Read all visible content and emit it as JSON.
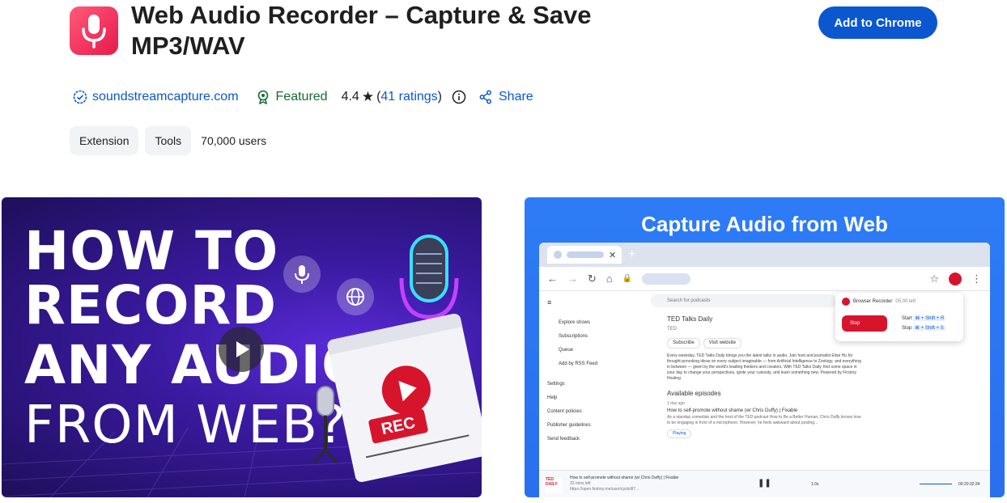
{
  "header": {
    "title": "Web Audio Recorder – Capture & Save MP3/WAV",
    "add_button": "Add to Chrome",
    "icon": "microphone-icon",
    "icon_color": "#e8194b"
  },
  "meta": {
    "site": "soundstreamcapture.com",
    "featured": "Featured",
    "rating": "4.4",
    "ratings_open": "(",
    "ratings_count": "41 ratings",
    "ratings_close": ")",
    "share": "Share",
    "colors": {
      "link": "#0b57d0",
      "featured": "#146c2e"
    }
  },
  "chips": [
    "Extension",
    "Tools"
  ],
  "users": "70,000 users",
  "screenshot_left": {
    "lines": [
      "HOW TO",
      "RECORD",
      "ANY AUDIO",
      "FROM WEB?"
    ],
    "rec": "REC"
  },
  "screenshot_right": {
    "title": "Capture Audio from Web",
    "sidebar": [
      "Explore shows",
      "Subscriptions",
      "Queue",
      "Add by RSS Feed",
      "Settings",
      "Help",
      "Content policies",
      "Publisher guidelines",
      "Send feedback"
    ],
    "podcast": "TED Talks Daily",
    "publisher": "TED",
    "subscribe": "Subscribe",
    "visit": "Visit website",
    "description": "Every weekday, TED Talks Daily brings you the latest talks in audio. Join host and journalist Elise Hu for thought-provoking ideas on every subject imaginable — from Artificial Intelligence to Zoology, and everything in between — given by the world's leading thinkers and creators. With TED Talks Daily, find some space in your day to change your perspectives, ignite your curiosity, and learn something new. Powered by Firstory Hosting",
    "available": "Available episodes",
    "episode_age": "1 day ago",
    "episode_title": "How to self-promote without shame (w/ Chris Duffy) | Fixable",
    "episode_desc": "As a standup comedian and the host of the TED podcast How to Be a Better Human, Chris Duffy knows how to be engaging in front of a microphone. However, he feels awkward about posting...",
    "playing": "Playing",
    "search": "Search for podcasts",
    "recorder": {
      "name": "Browser Recorder",
      "left": "05:00 left",
      "stop": "Stop",
      "start_label": "Start",
      "start_keys": "⌘ + Shift + R",
      "stop_label": "Stop",
      "stop_keys": "⌘ + Shift + S"
    },
    "player": {
      "title": "How to self-promote without shame (w/ Chris Duffy) | Fixable",
      "remaining": "32 mins left",
      "url": "https://open.firstory.me/user/cjcdx9f7...",
      "speed": "1.0x",
      "time": "00:20:32:34"
    }
  }
}
